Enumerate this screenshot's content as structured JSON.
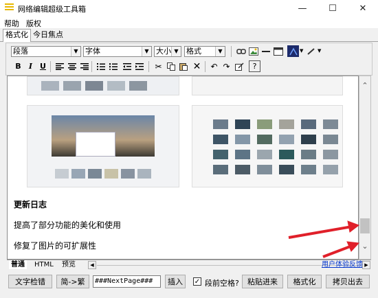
{
  "window": {
    "title": "网络编辑超级工具箱",
    "minimize": "—",
    "maximize": "☐",
    "close": "✕"
  },
  "menu": [
    "帮助",
    "版权"
  ],
  "tabs": [
    "格式化",
    "今日焦点"
  ],
  "toolbar": {
    "paragraph": "段落",
    "font": "字体",
    "size": "大小",
    "format": "格式",
    "bold": "B",
    "italic": "I",
    "underline": "U"
  },
  "editor": {
    "heading": "更新日志",
    "lines": [
      "提高了部分功能的美化和使用",
      "修复了图片的可扩展性"
    ]
  },
  "bottom_tabs": [
    "普通",
    "HTML",
    "预览"
  ],
  "feedback_link": "用户体验反馈",
  "bottombar": {
    "spellcheck": "文字检错",
    "convert": "简->繁",
    "insert_value": "###NextPage###",
    "insert": "插入",
    "indent_label": "段前空格?",
    "indent_checked": true,
    "paste_in": "粘贴进来",
    "format": "格式化",
    "copy_out": "拷贝出去"
  },
  "colors": {
    "accent_arrow": "#e0202a",
    "link": "#0033cc",
    "font_color_swatch": "#1d2b6b"
  }
}
